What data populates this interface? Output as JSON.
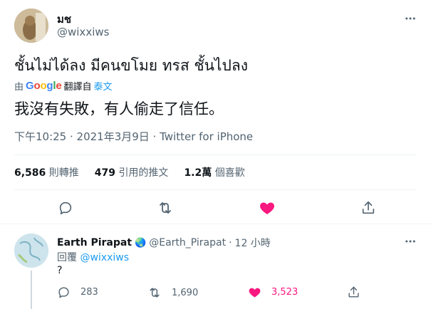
{
  "tweet": {
    "display_name": "มช",
    "handle": "@wixxiws",
    "text": "ชั้นไม่ได้ลง มีคนขโมย ทรส ชั้นไปลง",
    "translated_by_prefix": "由",
    "translated_by_brand": "Google",
    "translated_by_suffix": "翻譯自",
    "translated_by_lang": "泰文",
    "translation": "我沒有失敗，有人偷走了信任。",
    "timestamp": "下午10:25 · 2021年3月9日 · Twitter for iPhone",
    "retweets_count": "6,586",
    "retweets_label": "則轉推",
    "quotes_count": "479",
    "quotes_label": "引用的推文",
    "likes_count": "1.2萬",
    "likes_label": "個喜歡"
  },
  "reply": {
    "display_name": "Earth Pirapat",
    "emoji": "🌏",
    "handle": "@Earth_Pirapat",
    "separator": "·",
    "time": "12 小時",
    "replying_prefix": "回覆",
    "replying_to": "@wixxiws",
    "text": "?",
    "reply_count": "283",
    "retweet_count": "1,690",
    "like_count": "3,523"
  },
  "icons": {
    "more": "more-dots-icon",
    "reply": "reply-icon",
    "retweet": "retweet-icon",
    "like": "heart-icon",
    "share": "share-icon"
  },
  "colors": {
    "like_red": "#f91880",
    "link_blue": "#1d9bf0",
    "muted": "#536471",
    "google_blue": "#4285F4",
    "google_red": "#EA4335",
    "google_yellow": "#FBBC05",
    "google_green": "#34A853"
  }
}
